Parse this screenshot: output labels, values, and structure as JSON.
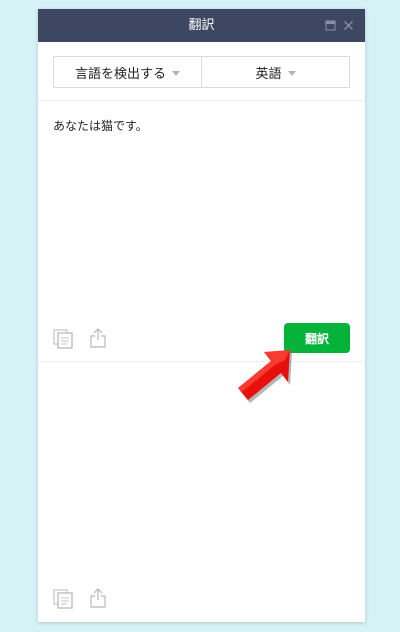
{
  "window": {
    "title": "翻訳"
  },
  "languages": {
    "source": "言語を検出する",
    "target": "英語"
  },
  "input": {
    "text": "あなたは猫です。"
  },
  "actions": {
    "translate_label": "翻訳"
  },
  "icons": [
    "minimize-icon",
    "close-icon",
    "copy-icon",
    "share-icon",
    "dropdown-caret-icon"
  ],
  "colors": {
    "titlebar": "#3e4762",
    "translate_button": "#06b33a",
    "background": "#d6f2f7",
    "annotation_arrow": "#e8100c"
  }
}
